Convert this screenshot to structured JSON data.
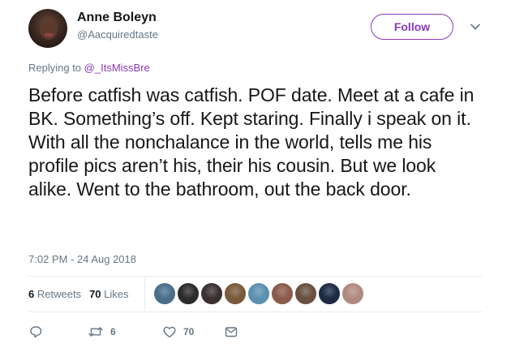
{
  "tweet": {
    "author_name": "Anne Boleyn",
    "author_handle": "@Aacquiredtaste",
    "follow_label": "Follow",
    "reply_prefix": "Replying to",
    "reply_handle": "@_ItsMissBre",
    "text": "Before catfish was catfish. POF date. Meet at a cafe in BK. Something’s off. Kept staring. Finally i speak on it. With all the nonchalance in the world, tells me his profile pics aren’t his, their his cousin. But we look alike. Went to the bathroom, out the back door.",
    "timestamp": "7:02 PM - 24 Aug 2018",
    "retweets_count": "6",
    "retweets_label": "Retweets",
    "likes_count": "70",
    "likes_label": "Likes",
    "action_retweet_count": "6",
    "action_like_count": "70"
  },
  "icons": {
    "caret": "chevron-down-icon",
    "reply": "reply-icon",
    "retweet": "retweet-icon",
    "like": "heart-icon",
    "message": "direct-message-icon"
  },
  "colors": {
    "accent": "#8a3ab9",
    "text_primary": "#14171a",
    "text_secondary": "#657786",
    "divider": "#e6ecf0"
  },
  "likers": [
    {
      "color": "#4a6e8a"
    },
    {
      "color": "#2b2b2b"
    },
    {
      "color": "#3a3030"
    },
    {
      "color": "#7a5a3a"
    },
    {
      "color": "#5c8fb0"
    },
    {
      "color": "#8b5a4a"
    },
    {
      "color": "#6a5040"
    },
    {
      "color": "#1d2a44"
    },
    {
      "color": "#b08a80"
    }
  ]
}
